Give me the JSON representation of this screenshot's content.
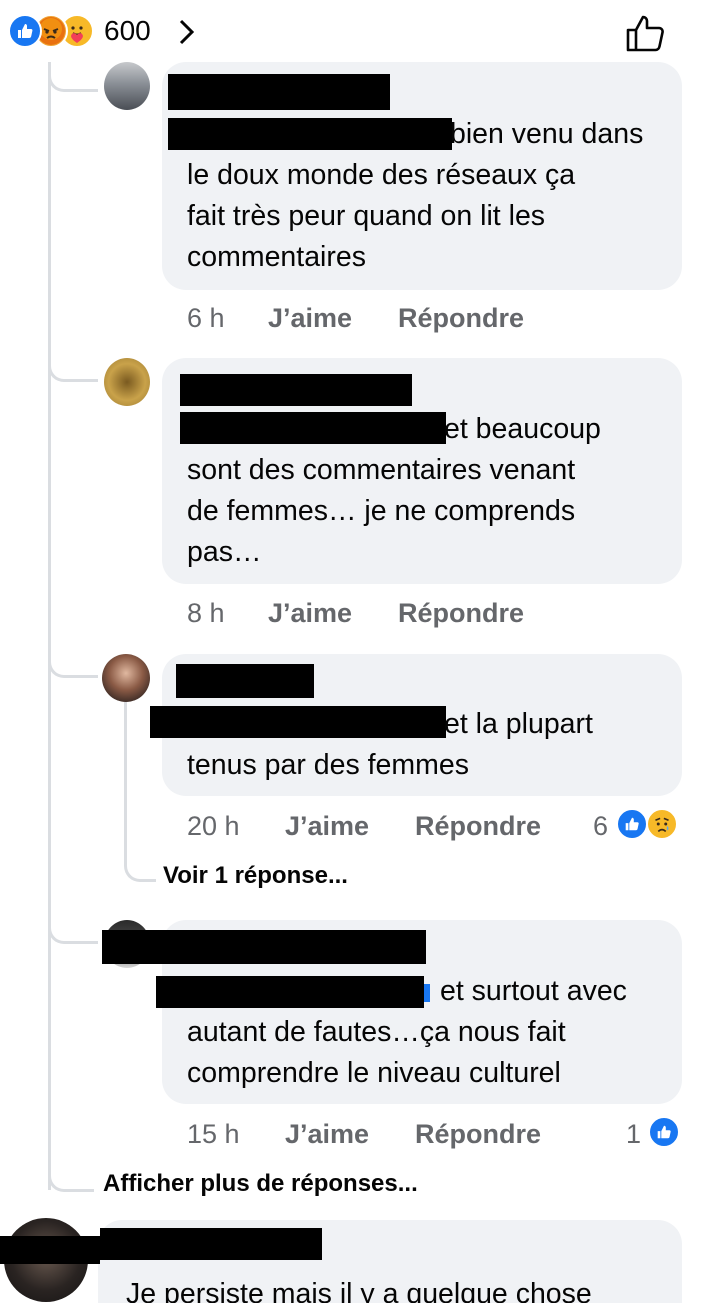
{
  "header": {
    "reaction_icons": [
      "like-icon",
      "angry-icon",
      "care-icon"
    ],
    "reaction_count": "600"
  },
  "comments": [
    {
      "text_lines": [
        "bien venu dans",
        "le doux monde des réseaux ça",
        "fait très peur quand on lit les",
        "commentaires"
      ],
      "time": "6 h",
      "like_label": "J’aime",
      "reply_label": "Répondre"
    },
    {
      "text_lines": [
        "et beaucoup",
        "sont des commentaires venant",
        "de femmes… je ne comprends",
        "pas…"
      ],
      "time": "8 h",
      "like_label": "J’aime",
      "reply_label": "Répondre"
    },
    {
      "text_lines": [
        "et la plupart",
        "tenus par des femmes"
      ],
      "time": "20 h",
      "like_label": "J’aime",
      "reply_label": "Répondre",
      "reaction_count": "6",
      "replies_link": "Voir 1 réponse..."
    },
    {
      "text_lines": [
        "et surtout avec",
        "autant de fautes…ça nous fait",
        "comprendre le niveau culturel"
      ],
      "time": "15 h",
      "like_label": "J’aime",
      "reply_label": "Répondre",
      "reaction_count": "1"
    }
  ],
  "more_replies": "Afficher plus de réponses...",
  "last_comment": {
    "text": "Je persiste mais il y a quelque chose"
  },
  "colors": {
    "like_blue": "#1877f2",
    "bubble_bg": "#f0f2f5",
    "meta_gray": "#65676b"
  }
}
